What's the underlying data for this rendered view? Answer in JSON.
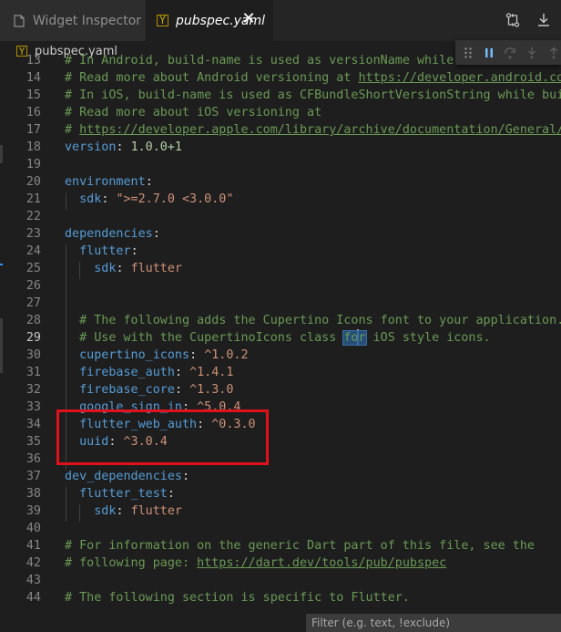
{
  "tabs": [
    {
      "label": "Widget Inspector"
    },
    {
      "label": "pubspec.yaml",
      "icon": "Y"
    }
  ],
  "breadcrumb": {
    "icon": "Y",
    "file": "pubspec.yaml"
  },
  "editor": {
    "lines": [
      {
        "n": "13",
        "tokens": [
          {
            "t": "# In Android, build-name is used as versionName while bu",
            "c": "c"
          }
        ]
      },
      {
        "n": "14",
        "tokens": [
          {
            "t": "# Read more about Android versioning at ",
            "c": "c"
          },
          {
            "t": "https://developer.android.com/s",
            "c": "cl"
          }
        ]
      },
      {
        "n": "15",
        "tokens": [
          {
            "t": "# In iOS, build-name is used as CFBundleShortVersionString while build-",
            "c": "c"
          }
        ]
      },
      {
        "n": "16",
        "tokens": [
          {
            "t": "# Read more about iOS versioning at",
            "c": "c"
          }
        ]
      },
      {
        "n": "17",
        "tokens": [
          {
            "t": "# ",
            "c": "c"
          },
          {
            "t": "https://developer.apple.com/library/archive/documentation/General/Ref",
            "c": "cl"
          }
        ]
      },
      {
        "n": "18",
        "tokens": [
          {
            "t": "version",
            "c": "k"
          },
          {
            "t": ": ",
            "c": "p"
          },
          {
            "t": "1.0.0+1",
            "c": "n"
          }
        ]
      },
      {
        "n": "19",
        "tokens": []
      },
      {
        "n": "20",
        "tokens": [
          {
            "t": "environment",
            "c": "k"
          },
          {
            "t": ":",
            "c": "p"
          }
        ]
      },
      {
        "n": "21",
        "tokens": [
          {
            "t": "  sdk",
            "c": "k"
          },
          {
            "t": ": ",
            "c": "p"
          },
          {
            "t": "\">=2.7.0 <3.0.0\"",
            "c": "s"
          }
        ]
      },
      {
        "n": "22",
        "tokens": []
      },
      {
        "n": "23",
        "tokens": [
          {
            "t": "dependencies",
            "c": "k"
          },
          {
            "t": ":",
            "c": "p"
          }
        ]
      },
      {
        "n": "24",
        "tokens": [
          {
            "t": "  flutter",
            "c": "k"
          },
          {
            "t": ":",
            "c": "p"
          }
        ]
      },
      {
        "n": "25",
        "tokens": [
          {
            "t": "    sdk",
            "c": "k"
          },
          {
            "t": ": ",
            "c": "p"
          },
          {
            "t": "flutter",
            "c": "v"
          }
        ]
      },
      {
        "n": "26",
        "tokens": []
      },
      {
        "n": "27",
        "tokens": []
      },
      {
        "n": "28",
        "tokens": [
          {
            "t": "  # The following adds the Cupertino Icons font to your application.",
            "c": "c"
          }
        ]
      },
      {
        "n": "29",
        "tokens": [
          {
            "t": "  # Use with the CupertinoIcons class ",
            "c": "c"
          },
          {
            "t": "fo",
            "c": "c cursor-word"
          },
          {
            "t": "",
            "c": "caret"
          },
          {
            "t": "r",
            "c": "c cursor-word"
          },
          {
            "t": " iOS style icons.",
            "c": "c"
          }
        ],
        "active": true
      },
      {
        "n": "30",
        "tokens": [
          {
            "t": "  cupertino_icons",
            "c": "k"
          },
          {
            "t": ": ",
            "c": "p"
          },
          {
            "t": "^1.0.2",
            "c": "v"
          }
        ]
      },
      {
        "n": "31",
        "tokens": [
          {
            "t": "  firebase_auth",
            "c": "k"
          },
          {
            "t": ": ",
            "c": "p"
          },
          {
            "t": "^1.4.1",
            "c": "v"
          }
        ]
      },
      {
        "n": "32",
        "tokens": [
          {
            "t": "  firebase_core",
            "c": "k"
          },
          {
            "t": ": ",
            "c": "p"
          },
          {
            "t": "^1.3.0",
            "c": "v"
          }
        ]
      },
      {
        "n": "33",
        "tokens": [
          {
            "t": "  google_sign_in",
            "c": "k"
          },
          {
            "t": ": ",
            "c": "p"
          },
          {
            "t": "^5.0.4",
            "c": "v"
          }
        ]
      },
      {
        "n": "34",
        "tokens": [
          {
            "t": "  flutter_web_auth",
            "c": "k"
          },
          {
            "t": ": ",
            "c": "p"
          },
          {
            "t": "^0.3.0",
            "c": "v"
          }
        ]
      },
      {
        "n": "35",
        "tokens": [
          {
            "t": "  uuid",
            "c": "k"
          },
          {
            "t": ": ",
            "c": "p"
          },
          {
            "t": "^3.0.4",
            "c": "v"
          }
        ]
      },
      {
        "n": "36",
        "tokens": []
      },
      {
        "n": "37",
        "tokens": [
          {
            "t": "dev_dependencies",
            "c": "k"
          },
          {
            "t": ":",
            "c": "p"
          }
        ]
      },
      {
        "n": "38",
        "tokens": [
          {
            "t": "  flutter_test",
            "c": "k"
          },
          {
            "t": ":",
            "c": "p"
          }
        ]
      },
      {
        "n": "39",
        "tokens": [
          {
            "t": "    sdk",
            "c": "k"
          },
          {
            "t": ": ",
            "c": "p"
          },
          {
            "t": "flutter",
            "c": "v"
          }
        ]
      },
      {
        "n": "40",
        "tokens": []
      },
      {
        "n": "41",
        "tokens": [
          {
            "t": "# For information on the generic Dart part of this file, see the",
            "c": "c"
          }
        ]
      },
      {
        "n": "42",
        "tokens": [
          {
            "t": "# following page: ",
            "c": "c"
          },
          {
            "t": "https://dart.dev/tools/pub/pubspec",
            "c": "cl"
          }
        ]
      },
      {
        "n": "43",
        "tokens": []
      },
      {
        "n": "44",
        "tokens": [
          {
            "t": "# The following section is specific to Flutter.",
            "c": "c"
          }
        ]
      }
    ]
  },
  "filter": {
    "placeholder": "Filter (e.g. text, !exclude)"
  },
  "colors": {
    "highlight": "#e0111b",
    "comment": "#6a9955",
    "key": "#569cd6",
    "value": "#ce9178",
    "number": "#b5cea8"
  }
}
